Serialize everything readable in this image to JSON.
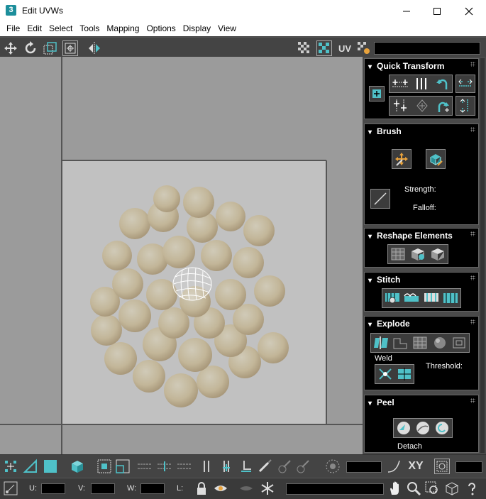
{
  "window": {
    "app_icon": "3",
    "title": "Edit UVWs"
  },
  "menu": [
    "File",
    "Edit",
    "Select",
    "Tools",
    "Mapping",
    "Options",
    "Display",
    "View"
  ],
  "toolbar": {
    "uv_label": "UV"
  },
  "panel": {
    "quick_transform": {
      "title": "Quick Transform"
    },
    "brush": {
      "title": "Brush",
      "strength_label": "Strength:",
      "falloff_label": "Falloff:"
    },
    "reshape": {
      "title": "Reshape Elements"
    },
    "stitch": {
      "title": "Stitch"
    },
    "explode": {
      "title": "Explode",
      "weld_label": "Weld",
      "threshold_label": "Threshold:"
    },
    "peel": {
      "title": "Peel",
      "detach_label": "Detach"
    }
  },
  "bottom": {
    "xy_label": "XY",
    "u_label": "U:",
    "v_label": "V:",
    "w_label": "W:",
    "l_label": "L:"
  },
  "colors": {
    "accent": "#4fc1c8",
    "panel_bg": "#000000",
    "viewport_bg": "#a9a9a9"
  }
}
